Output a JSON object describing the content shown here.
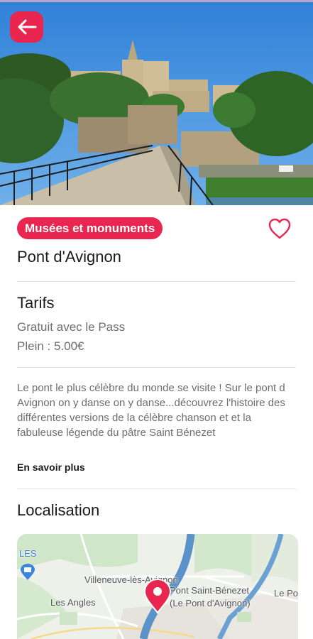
{
  "header": {
    "back_icon": "arrow-left-icon"
  },
  "place": {
    "category": "Musées et monuments",
    "name": "Pont d'Avignon",
    "favorite_icon": "heart-outline-icon"
  },
  "tarifs": {
    "heading": "Tarifs",
    "lines": [
      "Gratuit avec le Pass",
      "Plein : 5.00€"
    ]
  },
  "description": {
    "text": "Le pont le plus célèbre du monde se visite ! Sur le pont d Avignon on y danse on y danse...découvrez l'histoire des différentes versions de la célèbre chanson et et la fabuleuse légende du pâtre Saint Bénezet",
    "more_label": "En savoir plus"
  },
  "localisation": {
    "heading": "Localisation",
    "map_labels": {
      "les": "LES",
      "villeneuve": "Villeneuve-lès-Avignon",
      "pont": "Pont Saint-Bénezet",
      "pont_sub": "(Le Pont d'Avignon)",
      "les_angles": "Les Angles",
      "le_po": "Le Po"
    },
    "marker_icon": "map-pin-icon"
  },
  "colors": {
    "accent": "#e8264f",
    "text": "#1a1a1a",
    "muted": "#6d6d6d",
    "divider": "#e2e2e2"
  }
}
